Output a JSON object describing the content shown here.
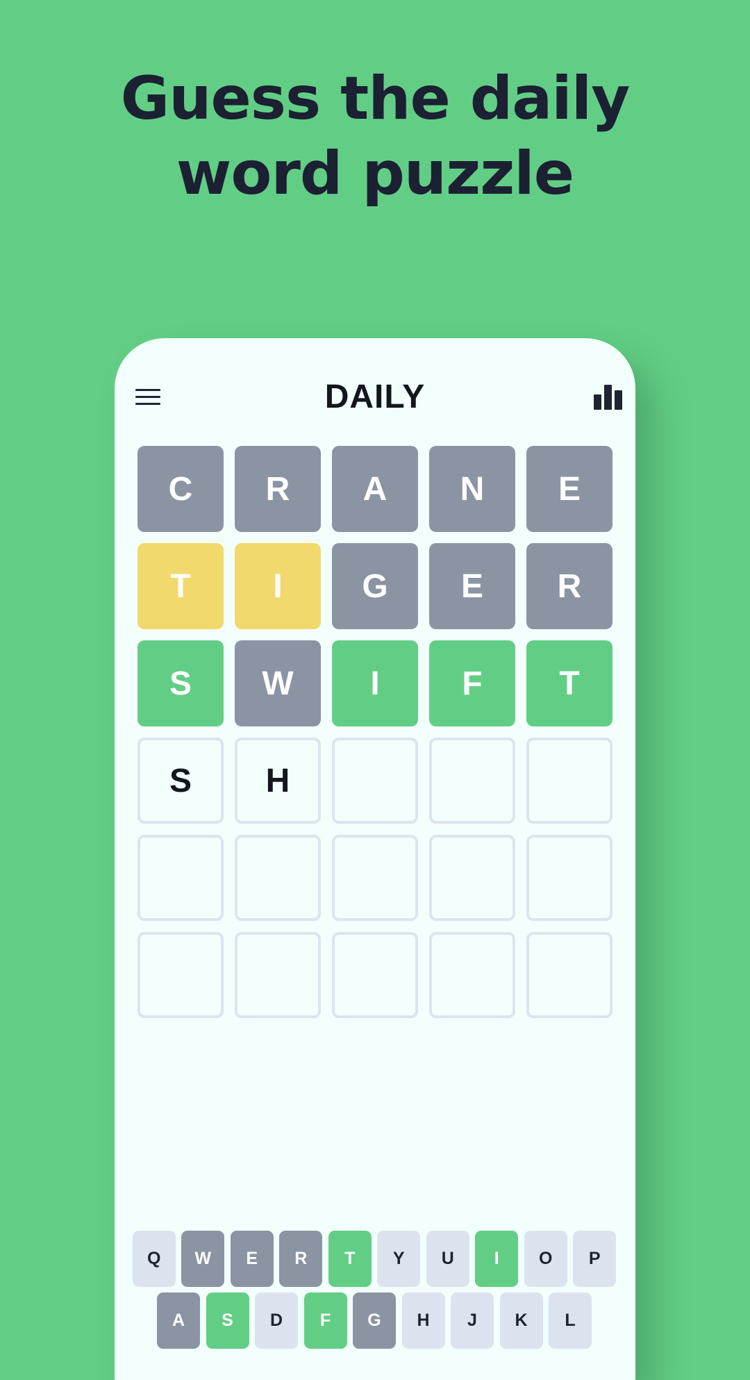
{
  "headline": {
    "line1": "Guess the daily",
    "line2": "word puzzle"
  },
  "app": {
    "title": "DAILY",
    "icons": {
      "menu": "menu-icon",
      "stats": "stats-icon"
    }
  },
  "colors": {
    "background": "#62CE85",
    "absent": "#8B94A3",
    "present": "#F2D96E",
    "correct": "#62CE85",
    "empty_border": "#DDE4EE"
  },
  "board": [
    [
      {
        "letter": "C",
        "state": "absent"
      },
      {
        "letter": "R",
        "state": "absent"
      },
      {
        "letter": "A",
        "state": "absent"
      },
      {
        "letter": "N",
        "state": "absent"
      },
      {
        "letter": "E",
        "state": "absent"
      }
    ],
    [
      {
        "letter": "T",
        "state": "present"
      },
      {
        "letter": "I",
        "state": "present"
      },
      {
        "letter": "G",
        "state": "absent"
      },
      {
        "letter": "E",
        "state": "absent"
      },
      {
        "letter": "R",
        "state": "absent"
      }
    ],
    [
      {
        "letter": "S",
        "state": "correct"
      },
      {
        "letter": "W",
        "state": "absent"
      },
      {
        "letter": "I",
        "state": "correct"
      },
      {
        "letter": "F",
        "state": "correct"
      },
      {
        "letter": "T",
        "state": "correct"
      }
    ],
    [
      {
        "letter": "S",
        "state": "empty"
      },
      {
        "letter": "H",
        "state": "empty"
      },
      {
        "letter": "",
        "state": "empty"
      },
      {
        "letter": "",
        "state": "empty"
      },
      {
        "letter": "",
        "state": "empty"
      }
    ],
    [
      {
        "letter": "",
        "state": "empty"
      },
      {
        "letter": "",
        "state": "empty"
      },
      {
        "letter": "",
        "state": "empty"
      },
      {
        "letter": "",
        "state": "empty"
      },
      {
        "letter": "",
        "state": "empty"
      }
    ],
    [
      {
        "letter": "",
        "state": "empty"
      },
      {
        "letter": "",
        "state": "empty"
      },
      {
        "letter": "",
        "state": "empty"
      },
      {
        "letter": "",
        "state": "empty"
      },
      {
        "letter": "",
        "state": "empty"
      }
    ]
  ],
  "keyboard": [
    [
      {
        "key": "Q",
        "state": "unused"
      },
      {
        "key": "W",
        "state": "absent"
      },
      {
        "key": "E",
        "state": "absent"
      },
      {
        "key": "R",
        "state": "absent"
      },
      {
        "key": "T",
        "state": "correct"
      },
      {
        "key": "Y",
        "state": "unused"
      },
      {
        "key": "U",
        "state": "unused"
      },
      {
        "key": "I",
        "state": "correct"
      },
      {
        "key": "O",
        "state": "unused"
      },
      {
        "key": "P",
        "state": "unused"
      }
    ],
    [
      {
        "key": "A",
        "state": "absent"
      },
      {
        "key": "S",
        "state": "correct"
      },
      {
        "key": "D",
        "state": "unused"
      },
      {
        "key": "F",
        "state": "correct"
      },
      {
        "key": "G",
        "state": "absent"
      },
      {
        "key": "H",
        "state": "unused"
      },
      {
        "key": "J",
        "state": "unused"
      },
      {
        "key": "K",
        "state": "unused"
      },
      {
        "key": "L",
        "state": "unused"
      }
    ]
  ]
}
